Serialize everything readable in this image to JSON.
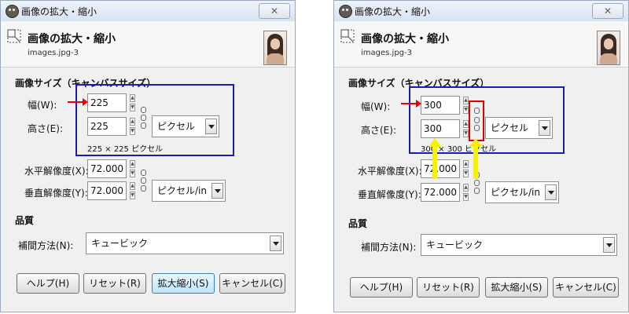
{
  "dialogs": [
    {
      "title": "画像の拡大・縮小",
      "close_glyph": "✕",
      "header_title": "画像の拡大・縮小",
      "header_sub": "images.jpg-3",
      "section_size": "画像サイズ（キャンバスサイズ）",
      "width_label": "幅(W):",
      "width_value": "225",
      "height_label": "高さ(E):",
      "height_value": "225",
      "unit": "ピクセル",
      "size_info": "225 × 225 ピクセル",
      "xres_label": "水平解像度(X):",
      "xres_value": "72.000",
      "yres_label": "垂直解像度(Y):",
      "yres_value": "72.000",
      "res_unit": "ピクセル/in",
      "section_quality": "品質",
      "interp_label": "補間方法(N):",
      "interp_value": "キュービック",
      "buttons": {
        "help": "ヘルプ(H)",
        "reset": "リセット(R)",
        "scale": "拡大縮小(S)",
        "cancel": "キャンセル(C)"
      }
    },
    {
      "title": "画像の拡大・縮小",
      "close_glyph": "✕",
      "header_title": "画像の拡大・縮小",
      "header_sub": "images.jpg-3",
      "section_size": "画像サイズ（キャンバスサイズ）",
      "width_label": "幅(W):",
      "width_value": "300",
      "height_label": "高さ(E):",
      "height_value": "300",
      "unit": "ピクセル",
      "size_info": "300 × 300 ピクセル",
      "xres_label": "水平解像度(X):",
      "xres_value": "72.000",
      "yres_label": "垂直解像度(Y):",
      "yres_value": "72.000",
      "res_unit": "ピクセル/in",
      "section_quality": "品質",
      "interp_label": "補間方法(N):",
      "interp_value": "キュービック",
      "buttons": {
        "help": "ヘルプ(H)",
        "reset": "リセット(R)",
        "scale": "拡大縮小(S)",
        "cancel": "キャンセル(C)"
      }
    }
  ],
  "annotation_colors": {
    "blue_box": "#1b1bb8",
    "red": "#ee0000",
    "yellow": "#f4f400"
  },
  "icons": [
    "gimp-icon",
    "close-icon",
    "scale-icon",
    "chain-linked-icon",
    "chain-broken-icon",
    "spin-arrows-icon",
    "dropdown-arrow-icon"
  ]
}
